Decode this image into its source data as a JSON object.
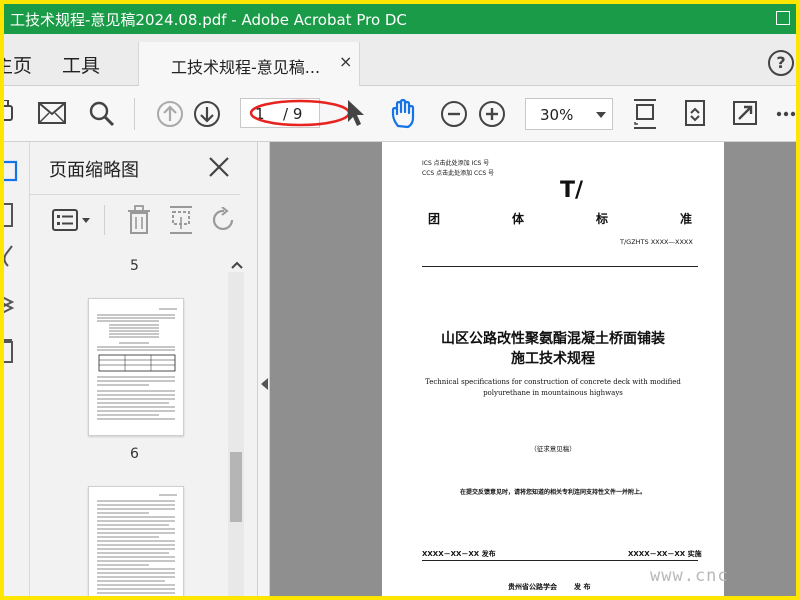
{
  "window": {
    "title": "工技术规程-意见稿2024.08.pdf - Adobe Acrobat Pro DC"
  },
  "menu": {
    "home_label": "主页",
    "tools_label": "工具"
  },
  "tab": {
    "label": "工技术规程-意见稿...",
    "close_glyph": "×"
  },
  "toolbar": {
    "page_current": "1",
    "page_total": "/ 9",
    "zoom_value": "30%"
  },
  "thumbnails_panel": {
    "title": "页面缩略图",
    "thumbs": [
      {
        "label": "5"
      },
      {
        "label": "6"
      }
    ]
  },
  "document": {
    "ics_line": "ICS  点击此处添加 ICS 号",
    "ccs_line": "CCS  点击此处添加 CCS 号",
    "t_mark": "T/",
    "std_type_chars": [
      "团",
      "体",
      "标",
      "准"
    ],
    "std_number": "T/GZHTS  XXXX—XXXX",
    "title_zh_line1": "山区公路改性聚氨酯混凝土桥面铺装",
    "title_zh_line2": "施工技术规程",
    "title_en_line1": "Technical specifications for construction of concrete deck with modified",
    "title_en_line2": "polyurethane in mountainous highways",
    "draft_note": "（征求意见稿）",
    "submit_note": "在提交反馈意见时，请将您知道的相关专利连同支持性文件一并附上。",
    "release_date": "XXXX－XX－XX 发布",
    "impl_date": "XXXX－XX－XX 实施",
    "publisher": "贵州省公路学会       发 布"
  },
  "watermark": "www.cnc",
  "colors": {
    "titlebar": "#199b47",
    "highlight_circle": "#e8231f",
    "hand_tool": "#1473e6",
    "outer_border": "#ffe600"
  }
}
